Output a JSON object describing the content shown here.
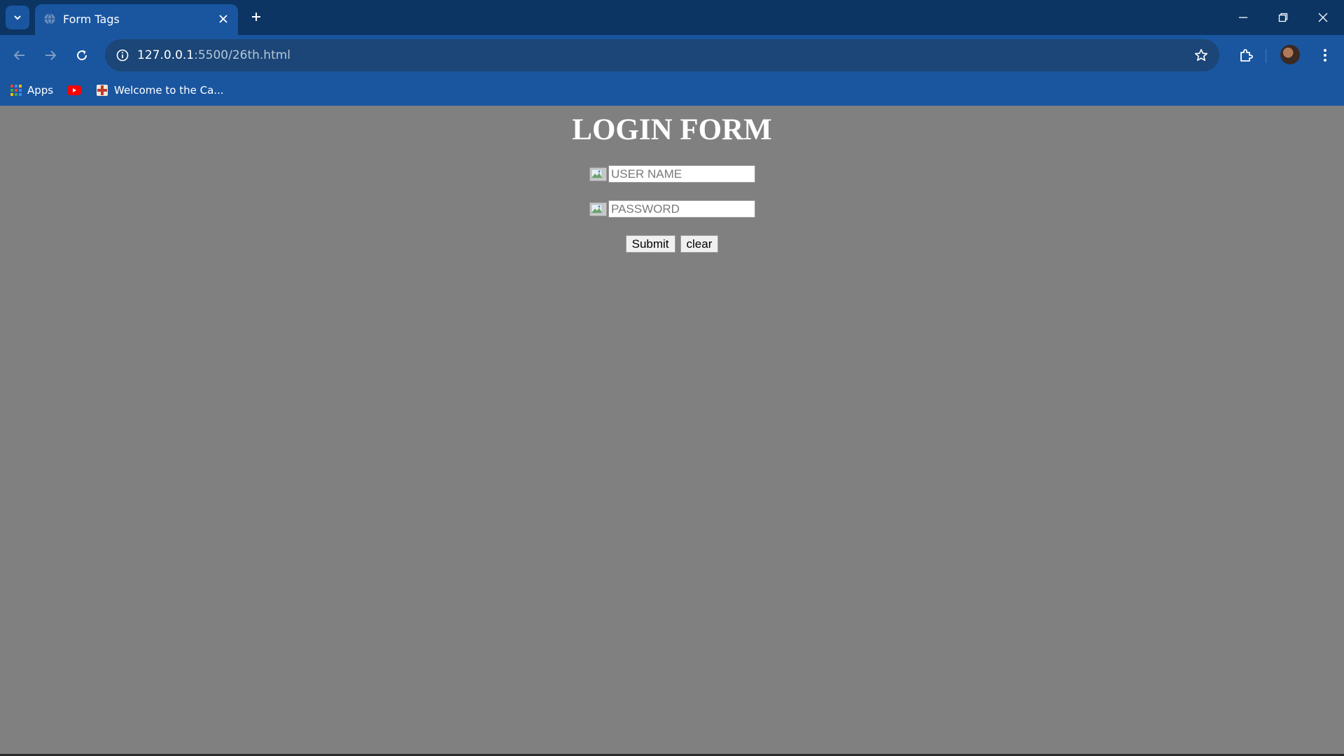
{
  "browser": {
    "tab": {
      "title": "Form Tags"
    },
    "address": {
      "host": "127.0.0.1",
      "path": ":5500/26th.html"
    },
    "bookmarks": [
      {
        "label": "Apps",
        "icon": "apps-grid-icon"
      },
      {
        "label": "",
        "icon": "youtube-icon"
      },
      {
        "label": "Welcome to the Ca...",
        "icon": "shield-cross-icon"
      }
    ]
  },
  "page": {
    "heading": "LOGIN FORM",
    "username": {
      "placeholder": "USER NAME",
      "value": ""
    },
    "password": {
      "placeholder": "PASSWORD",
      "value": ""
    },
    "submit_label": "Submit",
    "clear_label": "clear"
  },
  "colors": {
    "tabstrip": "#0c3564",
    "toolbar": "#1a56a0",
    "page_background": "#808080",
    "heading": "#ffffff"
  }
}
